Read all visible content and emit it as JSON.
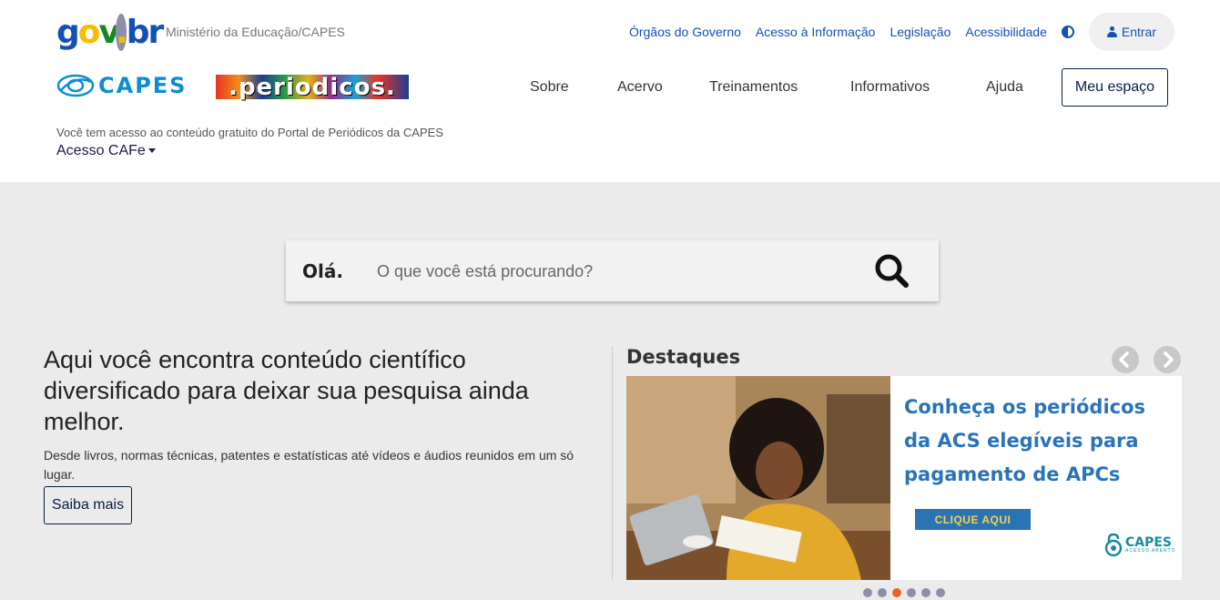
{
  "header": {
    "logo": {
      "g": "g",
      "o": "o",
      "v": "v",
      "dot": ".",
      "br": "br"
    },
    "ministry": "Ministério da Educação/CAPES",
    "links": [
      "Órgãos do Governo",
      "Acesso à Informação",
      "Legislação",
      "Acessibilidade"
    ],
    "contrast_icon": "contrast-icon",
    "login_label": "Entrar",
    "login_icon": "user-icon"
  },
  "brand": {
    "capes": "CAPES",
    "periodicos": ".periodicos."
  },
  "nav": {
    "items": [
      "Sobre",
      "Acervo",
      "Treinamentos",
      "Informativos",
      "Ajuda"
    ],
    "meu_espaco": "Meu espaço"
  },
  "access": {
    "note": "Você tem acesso ao conteúdo gratuito do Portal de Periódicos da CAPES",
    "cafe": "Acesso CAFe"
  },
  "search": {
    "greeting": "Olá.",
    "placeholder": "O que você está procurando?",
    "icon": "search-icon"
  },
  "intro": {
    "headline": "Aqui você encontra conteúdo científico diversificado para deixar sua pesquisa ainda melhor.",
    "description": "Desde livros, normas técnicas, patentes e estatísticas até vídeos e áudios reunidos em um só lugar.",
    "button": "Saiba mais"
  },
  "highlights": {
    "title": "Destaques",
    "slide_title": "Conheça os periódicos da ACS elegíveis para pagamento de APCs",
    "cta": "CLIQUE AQUI",
    "logo_text": "CAPES",
    "logo_sub": "ACESSO ABERTO",
    "slide_count": 6,
    "active_slide": 3
  },
  "colors": {
    "primary_blue": "#1351b4",
    "dark_navy": "#071d41",
    "slide_blue": "#2a74b6",
    "cta_yellow": "#f6d24a",
    "dot_active": "#e8622a",
    "dot_inactive": "#8e8ea8"
  }
}
